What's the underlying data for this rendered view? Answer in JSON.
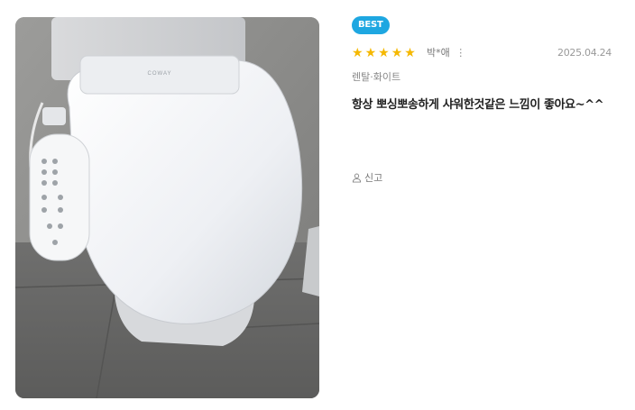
{
  "badge": "BEST",
  "rating": {
    "value": 5,
    "max": 5,
    "star_color": "#f5b800"
  },
  "author": "박*애",
  "author_menu_icon": "more-vertical-icon",
  "date": "2025.04.24",
  "option": "렌탈·화이트",
  "review_text": "항상 뽀싱뽀송하게 샤워한것같은 느낌이 좋아요~^^",
  "report_label": "신고",
  "report_icon": "report-person-icon",
  "photo_brand_text": "COWAY",
  "colors": {
    "badge": "#1ea7e1",
    "text": "#222222",
    "muted": "#888888"
  }
}
